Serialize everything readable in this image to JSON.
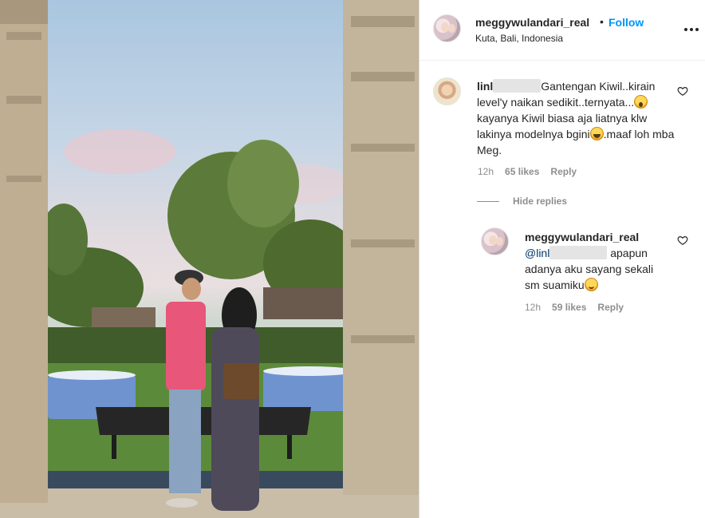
{
  "post": {
    "username": "meggywulandari_real",
    "separator": "•",
    "follow_label": "Follow",
    "location": "Kuta, Bali, Indonesia"
  },
  "comment": {
    "username_prefix": "linl",
    "text_1": "Gantengan Kiwil..kirain level'y naikan sedikit..ternyata...",
    "text_2": " kayanya Kiwil biasa aja liatnya klw lakinya modelnya bgini",
    "text_3": ".maaf loh mba Meg.",
    "time": "12h",
    "likes": "65 likes",
    "reply_label": "Reply",
    "emoji_1": "astonished-face-emoji",
    "emoji_2": "grinning-squinting-face-emoji"
  },
  "replies_toggle": {
    "label": "Hide replies"
  },
  "reply": {
    "username": "meggywulandari_real",
    "mention_prefix": "@linl",
    "text": " apapun adanya aku sayang sekali sm suamiku",
    "time": "12h",
    "likes": "59 likes",
    "reply_label": "Reply",
    "emoji": "smiling-face-emoji"
  },
  "colors": {
    "follow": "#0095f6",
    "text": "#262626",
    "secondary": "#8e8e8e",
    "mention": "#00376b"
  }
}
